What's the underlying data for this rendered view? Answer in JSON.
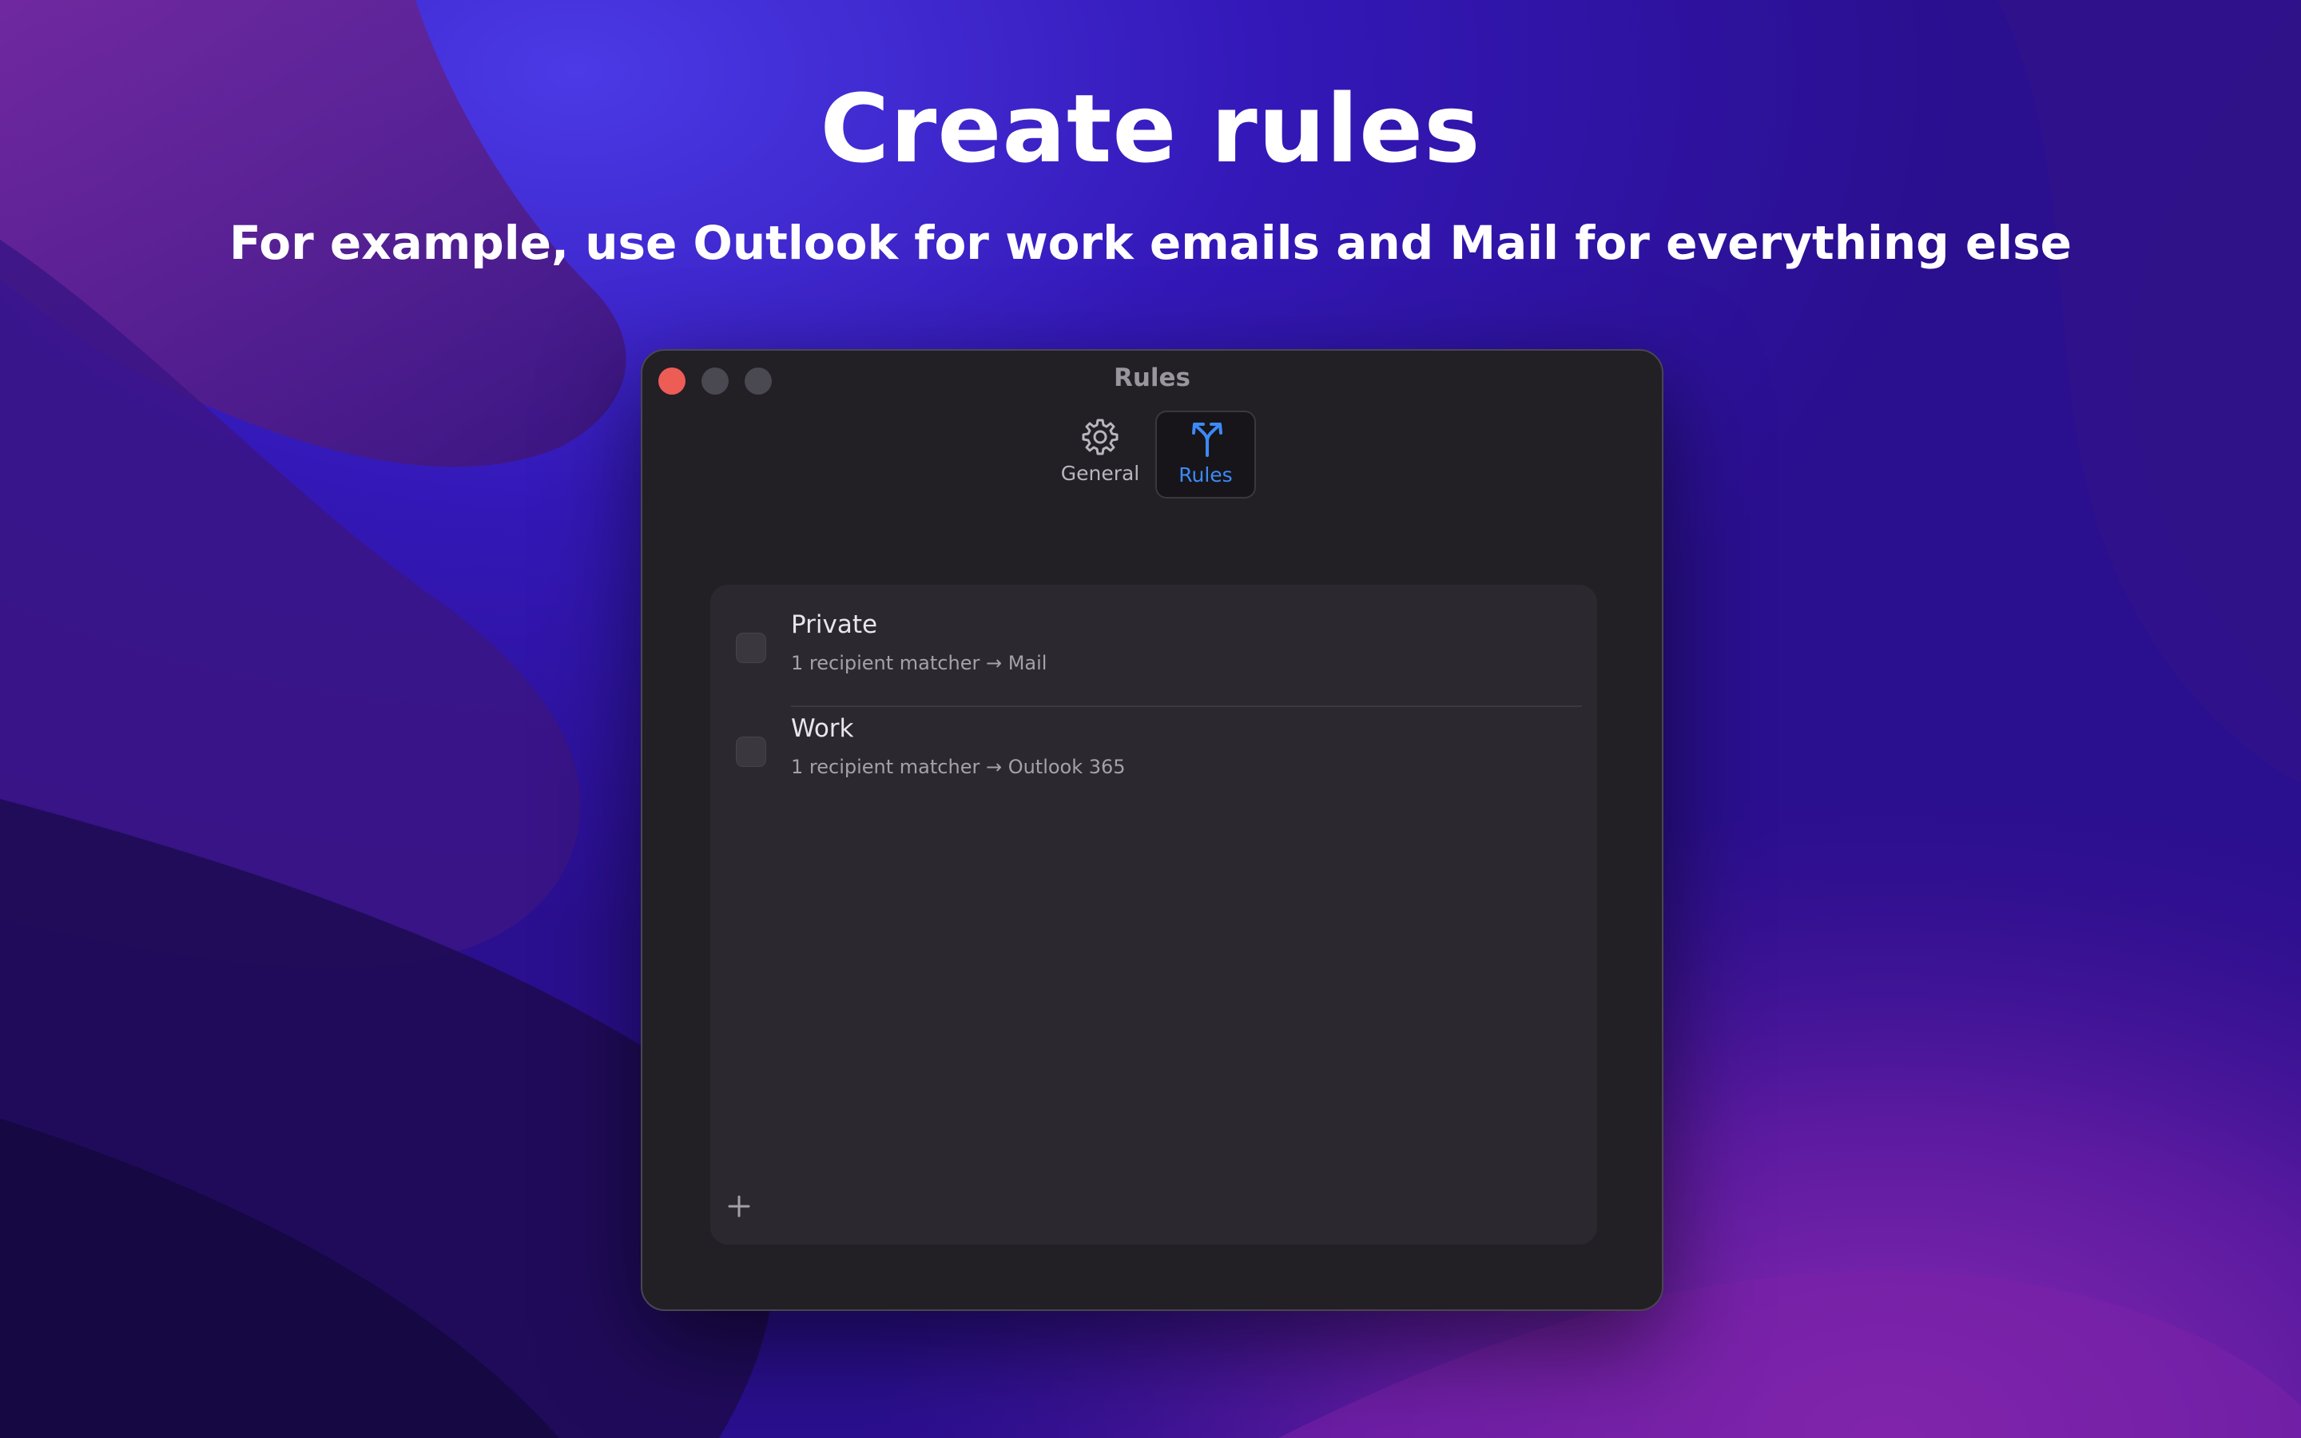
{
  "promo": {
    "title": "Create rules",
    "subtitle": "For example, use Outlook for work emails and Mail for everything else"
  },
  "window": {
    "title": "Rules",
    "toolbar": {
      "tabs": [
        {
          "label": "General",
          "icon": "gear-icon",
          "selected": false
        },
        {
          "label": "Rules",
          "icon": "fork-arrows-icon",
          "selected": true
        }
      ]
    },
    "rules": [
      {
        "name": "Private",
        "description": "1 recipient matcher → Mail",
        "enabled": false
      },
      {
        "name": "Work",
        "description": "1 recipient matcher → Outlook 365",
        "enabled": false
      }
    ],
    "add_button": {
      "icon": "plus-icon"
    }
  },
  "colors": {
    "accent": "#3d8af7",
    "close_button": "#ee5c56",
    "window_bg": "#221f25",
    "panel_bg": "#2b2830"
  }
}
